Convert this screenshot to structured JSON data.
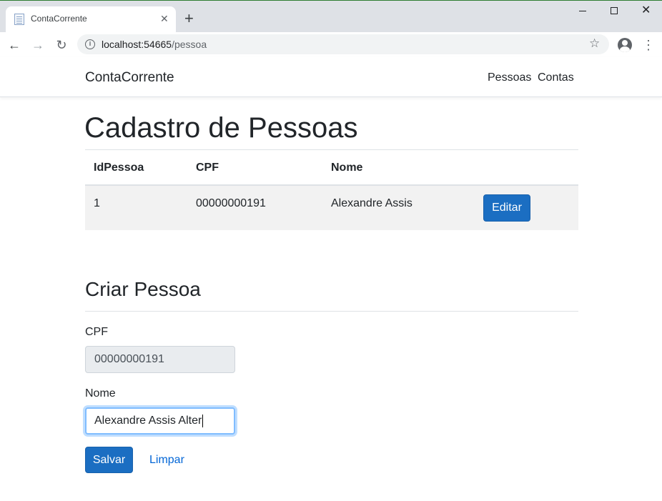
{
  "browser": {
    "tab_title": "ContaCorrente",
    "url_host": "localhost:54665",
    "url_path": "/pessoa"
  },
  "navbar": {
    "brand": "ContaCorrente",
    "links": [
      "Pessoas",
      "Contas"
    ]
  },
  "list": {
    "title": "Cadastro de Pessoas",
    "columns": [
      "IdPessoa",
      "CPF",
      "Nome"
    ],
    "rows": [
      {
        "id": "1",
        "cpf": "00000000191",
        "nome": "Alexandre Assis",
        "action": "Editar"
      }
    ]
  },
  "form": {
    "title": "Criar Pessoa",
    "cpf_label": "CPF",
    "cpf_value": "00000000191",
    "nome_label": "Nome",
    "nome_value": "Alexandre Assis Alter",
    "save_label": "Salvar",
    "clear_label": "Limpar"
  },
  "colors": {
    "primary": "#1b6ec2",
    "link": "#0366d6",
    "focus": "#80bdff"
  }
}
